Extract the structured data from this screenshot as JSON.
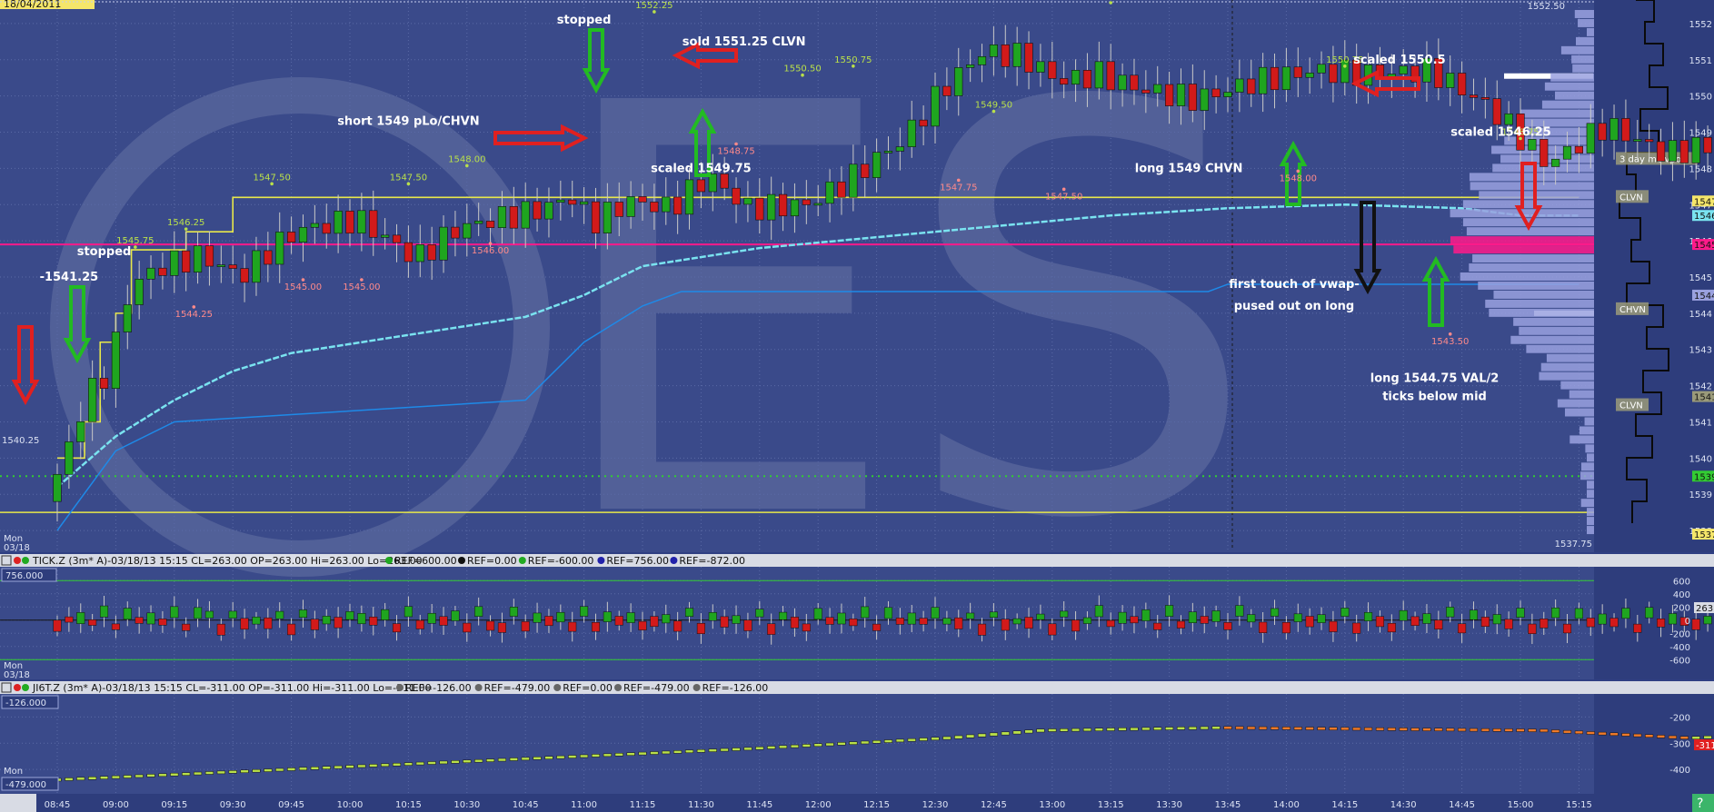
{
  "date_label": "18/04/2011",
  "colors": {
    "up": "#1fa51f",
    "down": "#d21a1a",
    "vwap": "#7ae3f0",
    "val": "#1e8ae8",
    "ib": "#e8e84a",
    "pink": "#ff1a8a",
    "green_dots": "#33cc33",
    "profile": "#9aa1df"
  },
  "chart_data": [
    {
      "type": "candlestick",
      "pane": "price",
      "x_ticks": [
        "08:45",
        "09:00",
        "09:15",
        "09:30",
        "09:45",
        "10:00",
        "10:15",
        "10:30",
        "10:45",
        "11:00",
        "11:15",
        "11:30",
        "11:45",
        "12:00",
        "12:15",
        "12:30",
        "12:45",
        "13:00",
        "13:15",
        "13:30",
        "13:45",
        "14:00",
        "14:15",
        "14:30",
        "14:45",
        "15:00",
        "15:15"
      ],
      "y_ticks": [
        "1552",
        "1551",
        "1550",
        "1549",
        "1548",
        "1547",
        "1546",
        "1545",
        "1544",
        "1543",
        "1542",
        "1541",
        "1540",
        "1539",
        "1538"
      ],
      "ylim": [
        1537.5,
        1552.5
      ],
      "top_value": "1552.50",
      "bottom_value": "1537.75",
      "start_label": "1540.25",
      "mon_label": "Mon",
      "date_label": "03/18",
      "high_labels": [
        {
          "time": "09:05",
          "value": 1545.75,
          "text": "1545.75"
        },
        {
          "time": "09:18",
          "value": 1546.25,
          "text": "1546.25"
        },
        {
          "time": "09:40",
          "value": 1547.5,
          "text": "1547.50"
        },
        {
          "time": "10:15",
          "value": 1547.5,
          "text": "1547.50"
        },
        {
          "time": "10:30",
          "value": 1548.0,
          "text": "1548.00"
        },
        {
          "time": "11:18",
          "value": 1552.25,
          "text": "1552.25"
        },
        {
          "time": "11:56",
          "value": 1550.5,
          "text": "1550.50"
        },
        {
          "time": "12:09",
          "value": 1550.75,
          "text": "1550.75"
        },
        {
          "time": "12:45",
          "value": 1549.5,
          "text": "1549.50"
        },
        {
          "time": "13:15",
          "value": 1552.5,
          "text": "1552.50"
        },
        {
          "time": "14:15",
          "value": 1550.75,
          "text": "1550.75"
        },
        {
          "time": "15:00",
          "value": 1548.75,
          "text": "1548.75"
        }
      ],
      "low_labels": [
        {
          "time": "09:20",
          "value": 1544.25,
          "text": "1544.25"
        },
        {
          "time": "09:48",
          "value": 1545.0,
          "text": "1545.00"
        },
        {
          "time": "10:03",
          "value": 1545.0,
          "text": "1545.00"
        },
        {
          "time": "10:36",
          "value": 1546.0,
          "text": "1546.00"
        },
        {
          "time": "11:39",
          "value": 1548.75,
          "text": "1548.75"
        },
        {
          "time": "12:36",
          "value": 1547.75,
          "text": "1547.75"
        },
        {
          "time": "13:03",
          "value": 1547.5,
          "text": "1547.50"
        },
        {
          "time": "14:03",
          "value": 1548.0,
          "text": "1548.00"
        },
        {
          "time": "14:42",
          "value": 1543.5,
          "text": "1543.50"
        }
      ],
      "annotations": [
        {
          "time": "08:48",
          "value": 1544.9,
          "text": "-1541.25"
        },
        {
          "time": "08:57",
          "value": 1545.6,
          "text": "stopped"
        },
        {
          "time": "11:00",
          "value": 1552.0,
          "text": "stopped"
        },
        {
          "time": "11:41",
          "value": 1551.4,
          "text": "sold 1551.25 CLVN"
        },
        {
          "time": "10:15",
          "value": 1549.2,
          "text": "short 1549 pLo/CHVN"
        },
        {
          "time": "11:30",
          "value": 1547.9,
          "text": "scaled 1549.75"
        },
        {
          "time": "14:29",
          "value": 1550.9,
          "text": "scaled 1550.5"
        },
        {
          "time": "14:55",
          "value": 1548.9,
          "text": "scaled 1546.25"
        },
        {
          "time": "13:35",
          "value": 1547.9,
          "text": "long 1549 CHVN"
        },
        {
          "time": "14:02",
          "value": 1544.7,
          "text": "first touch of vwap-"
        },
        {
          "time": "14:02",
          "value": 1544.1,
          "text": "pused out on long"
        },
        {
          "time": "14:38",
          "value": 1542.1,
          "text": "long 1544.75 VAL/2"
        },
        {
          "time": "14:38",
          "value": 1541.6,
          "text": "ticks below mid"
        }
      ],
      "profile_tags": [
        {
          "value": 1548.25,
          "text": "3 day mc vpoc"
        },
        {
          "value": 1547.2,
          "text": "CLVN"
        },
        {
          "value": 1544.1,
          "text": "CHVN"
        },
        {
          "value": 1541.45,
          "text": "CLVN"
        }
      ],
      "right_tags": [
        "1547",
        "1546",
        "1545",
        "1544",
        "1541",
        "1539",
        "1537"
      ]
    },
    {
      "type": "candlestick",
      "pane": "TICK",
      "header": "TICK.Z (3m* A)-03/18/13 15:15 CL=263.00 OP=263.00 Hi=263.00 Lo=263.00",
      "refs": [
        "REF=600.00",
        "REF=0.00",
        "REF=-600.00",
        "REF=756.00",
        "REF=-872.00"
      ],
      "level_box": "756.000",
      "y_ticks": [
        "600",
        "400",
        "200",
        "0",
        "-200",
        "-400",
        "-600"
      ],
      "ylim": [
        -872,
        756
      ],
      "last_value": "263",
      "mon_label": "Mon",
      "date_label": "03/18"
    },
    {
      "type": "candlestick",
      "pane": "JI6T",
      "header": "JI6T.Z (3m* A)-03/18/13 15:15 CL=-311.00 OP=-311.00 Hi=-311.00 Lo=-311.00",
      "refs": [
        "REF=-126.00",
        "REF=-479.00",
        "REF=0.00",
        "REF=-479.00",
        "REF=-126.00"
      ],
      "level_box_top": "-126.000",
      "level_box_bottom": "-479.000",
      "y_ticks": [
        "-200",
        "-300",
        "-400"
      ],
      "last_value": "-311",
      "mon_label": "Mon"
    }
  ],
  "notes_text": {
    "short": "short 1549 pLo/CHVN"
  }
}
